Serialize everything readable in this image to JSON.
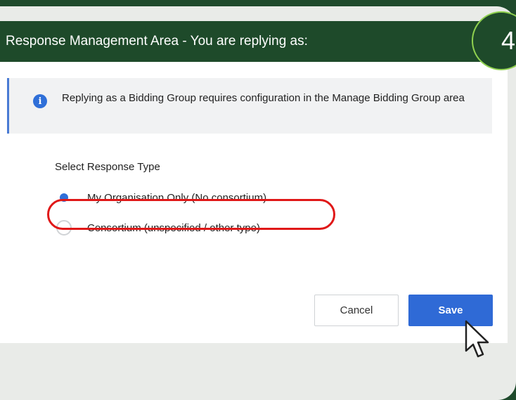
{
  "header": {
    "title": "Response Management Area - You are replying as:"
  },
  "step_badge": {
    "number": "4"
  },
  "info": {
    "icon": "info-icon",
    "message": "Replying as a Bidding Group requires configuration in the Manage Bidding Group area"
  },
  "response_type": {
    "label": "Select Response Type",
    "options": [
      {
        "label": "My Organisation Only (No consortium)",
        "selected": true,
        "highlighted": true
      },
      {
        "label": "Consortium (unspecified / other type)",
        "selected": false
      }
    ]
  },
  "buttons": {
    "cancel": "Cancel",
    "save": "Save"
  },
  "colors": {
    "header_bg": "#1e4a2a",
    "badge_border": "#8fd14f",
    "accent_blue": "#2f6ad6",
    "highlight_red": "#e01818"
  }
}
